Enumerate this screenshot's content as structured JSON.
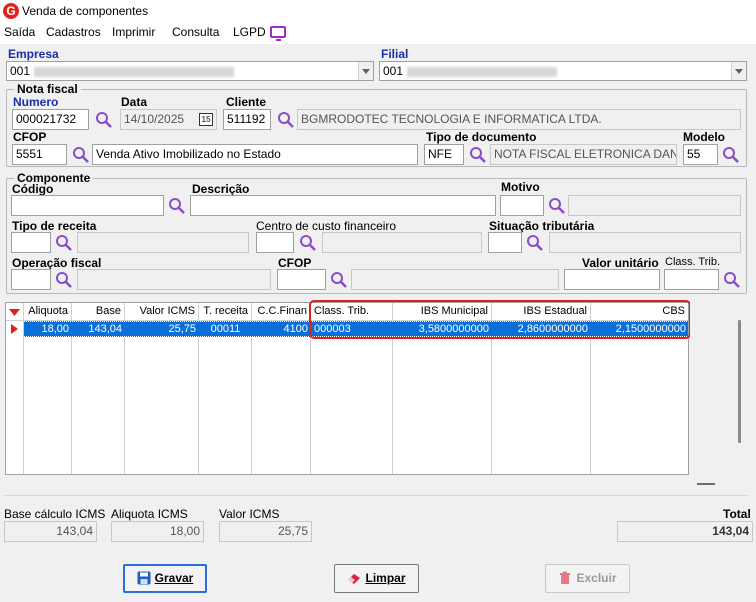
{
  "window": {
    "title": "Venda de componentes",
    "logo_letter": "G"
  },
  "menu": [
    "Saída",
    "Cadastros",
    "Imprimir",
    "Consulta",
    "LGPD"
  ],
  "empresa": {
    "label": "Empresa",
    "value": "001"
  },
  "filial": {
    "label": "Filial",
    "value": "001"
  },
  "nota_fiscal": {
    "title": "Nota fiscal",
    "numero_label": "Numero",
    "numero": "000021732",
    "data_label": "Data",
    "data": "14/10/2025",
    "calendar_day": "15",
    "cliente_label": "Cliente",
    "cliente_codigo": "511192",
    "cliente_nome": "BGMRODOTEC TECNOLOGIA E INFORMATICA LTDA.",
    "cfop_label": "CFOP",
    "cfop": "5551",
    "cfop_desc": "Venda Ativo Imobilizado no Estado",
    "tipo_doc_label": "Tipo de documento",
    "tipo_doc": "NFE",
    "tipo_doc_desc": "NOTA FISCAL ELETRONICA DANFE",
    "modelo_label": "Modelo",
    "modelo": "55"
  },
  "componente": {
    "title": "Componente",
    "codigo_label": "Código",
    "descricao_label": "Descrição",
    "motivo_label": "Motivo",
    "tipo_receita_label": "Tipo de receita",
    "centro_custo_label": "Centro de custo financeiro",
    "situacao_label": "Situação tributária",
    "operacao_label": "Operação fiscal",
    "cfop_label": "CFOP",
    "valor_unit_label": "Valor unitário",
    "class_trib_label": "Class. Trib."
  },
  "grid": {
    "columns": [
      "Aliquota",
      "Base",
      "Valor ICMS",
      "T. receita",
      "C.C.Finan",
      "Class. Trib.",
      "IBS Municipal",
      "IBS Estadual",
      "CBS"
    ],
    "rows": [
      [
        "18,00",
        "143,04",
        "25,75",
        "00011",
        "4100",
        "000003",
        "3,5800000000",
        "2,8600000000",
        "2,1500000000"
      ]
    ]
  },
  "totals": {
    "base_label": "Base cálculo ICMS",
    "base": "143,04",
    "aliquota_label": "Aliquota ICMS",
    "aliquota": "18,00",
    "valor_label": "Valor ICMS",
    "valor": "25,75",
    "total_label": "Total",
    "total": "143,04"
  },
  "buttons": {
    "gravar": "Gravar",
    "limpar": "Limpar",
    "excluir": "Excluir"
  },
  "colors": {
    "accent_blue": "#1a2fa6",
    "row_selected": "#0a6fd6",
    "highlight_red": "#e02020"
  }
}
